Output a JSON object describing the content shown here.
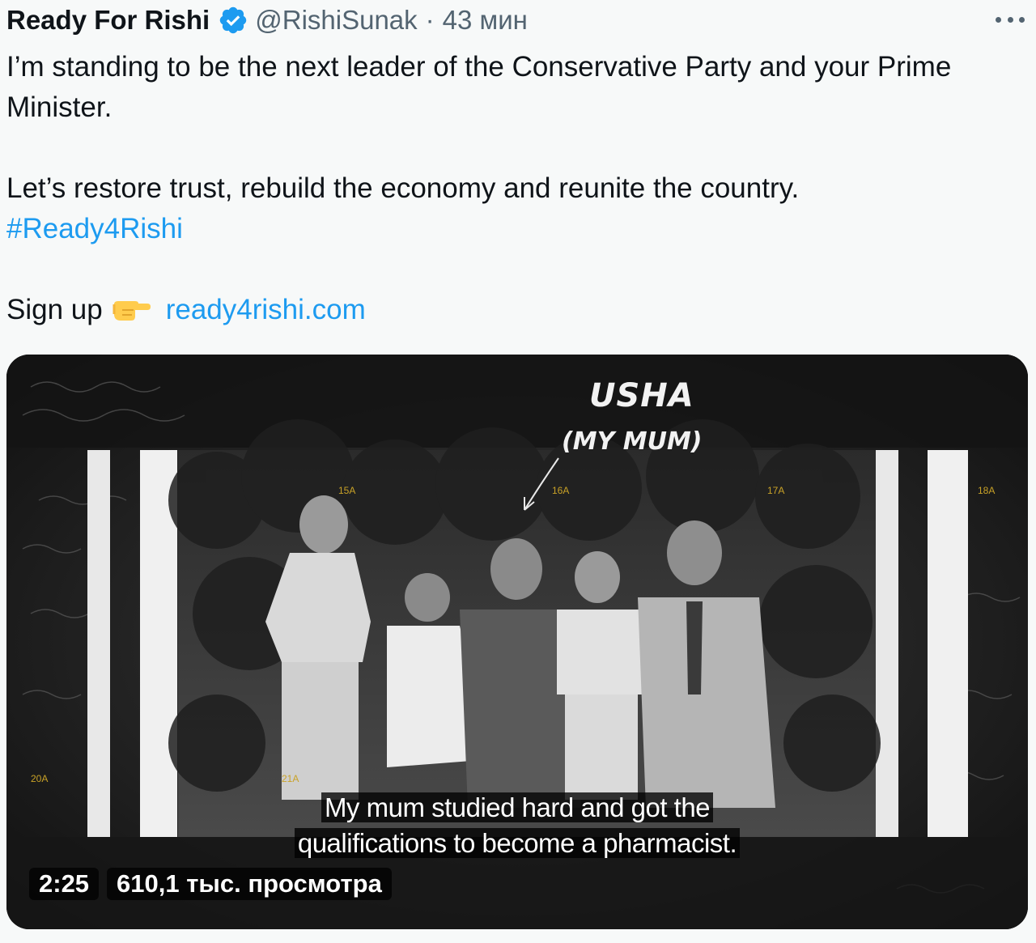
{
  "author": {
    "name": "Ready For Rishi",
    "handle": "@RishiSunak",
    "separator": "·",
    "time": "43 мин",
    "verified_icon": "verified-badge-icon",
    "verified_color": "#1d9bf0"
  },
  "more_icon": "more-horizontal-icon",
  "text": {
    "line1": "I’m standing to be the next leader of the Conservative Party and your Prime Minister.",
    "line2": "Let’s restore trust, rebuild the economy and reunite the country.",
    "hashtag": "#Ready4Rishi",
    "signup": "Sign up",
    "signup_emoji": "backhand-index-pointing-right",
    "link": "ready4rishi.com"
  },
  "video": {
    "overlay_name": "USHA",
    "overlay_sub": "(MY MUM)",
    "subtitle_line1": "My mum studied hard and got the",
    "subtitle_line2": "qualifications to become a pharmacist.",
    "duration": "2:25",
    "views": "610,1 тыс. просмотра",
    "film_frame_labels": [
      "15A",
      "16A",
      "17A",
      "18A",
      "20A",
      "21A"
    ]
  },
  "colors": {
    "link": "#1d9bf0",
    "secondary_text": "#536471",
    "primary_text": "#0f1419",
    "background": "#f7f9f9"
  }
}
